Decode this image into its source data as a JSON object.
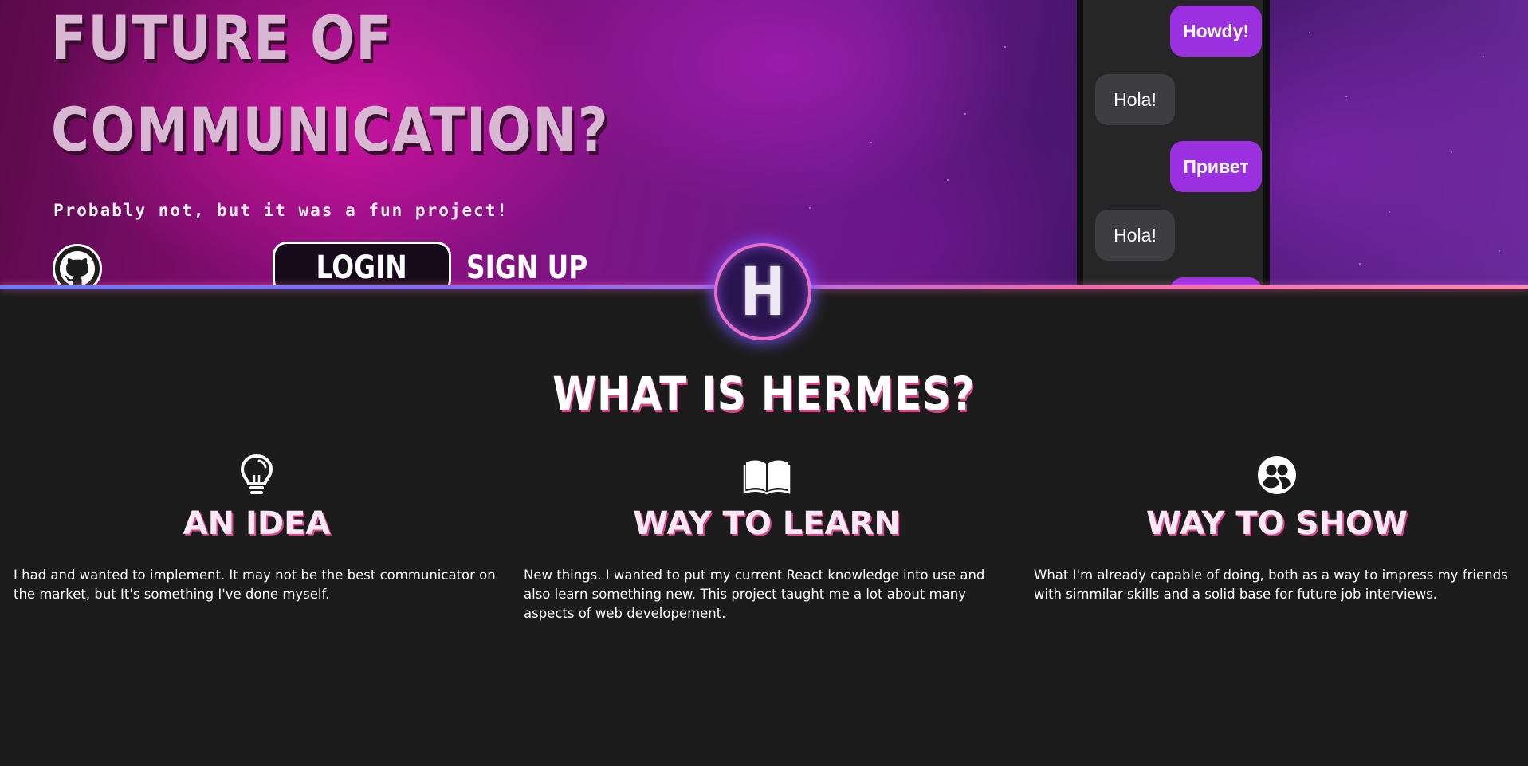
{
  "hero": {
    "title_line1": "FUTURE OF",
    "title_line2": "COMMUNICATION?",
    "subtitle": "Probably not, but it was a fun project!",
    "github_icon": "github-icon",
    "login_label": "LOGIN",
    "signup_label": "SIGN UP"
  },
  "phone": {
    "messages": [
      {
        "text": "Howdy!",
        "direction": "out"
      },
      {
        "text": "Hola!",
        "direction": "in"
      },
      {
        "text": "Привет",
        "direction": "out"
      },
      {
        "text": "Hola!",
        "direction": "in"
      }
    ]
  },
  "logo": {
    "letter": "H"
  },
  "about": {
    "title": "WHAT IS HERMES?",
    "features": [
      {
        "icon": "lightbulb-icon",
        "title": "AN IDEA",
        "text": "I had and wanted to implement. It may not be the best communicator on the market, but It's something I've done myself."
      },
      {
        "icon": "book-icon",
        "title": "WAY TO LEARN",
        "text": "New things. I wanted to put my current React knowledge into use and also learn something new. This project taught me a lot about many aspects of web developement."
      },
      {
        "icon": "users-icon",
        "title": "WAY TO SHOW",
        "text": "What I'm already capable of doing, both as a way to impress my friends with simmilar skills and a solid base for future job interviews."
      }
    ]
  },
  "colors": {
    "accent_purple": "#9b30e0",
    "accent_pink": "#e0408a",
    "background": "#1c1c1c"
  }
}
